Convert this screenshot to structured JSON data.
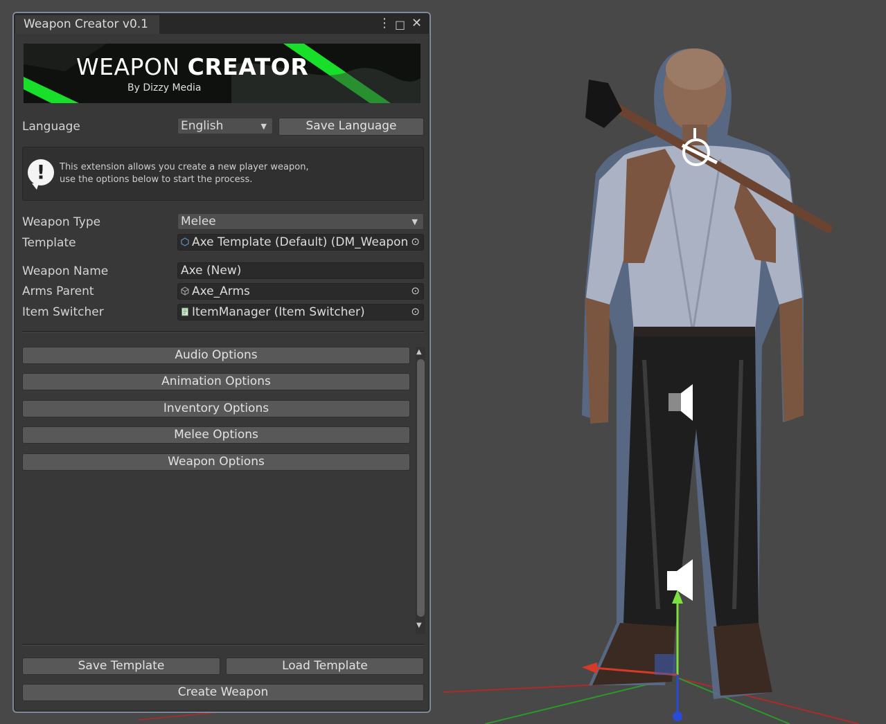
{
  "window": {
    "tab_title": "Weapon Creator v0.1",
    "controls": {
      "menu": "⋮",
      "maximize": "□",
      "close": "✕"
    }
  },
  "banner": {
    "title_light": "WEAPON",
    "title_bold": "CREATOR",
    "subtitle": "By Dizzy Media",
    "accent_color": "#18e02a"
  },
  "language": {
    "label": "Language",
    "selected": "English",
    "save_button": "Save Language"
  },
  "help": {
    "icon": "info-bubble-icon",
    "line1": "This extension allows you create a new player weapon,",
    "line2": "use the options below to start the process."
  },
  "fields": {
    "weapon_type": {
      "label": "Weapon Type",
      "value": "Melee"
    },
    "template": {
      "label": "Template",
      "value": "Axe Template (Default) (DM_Weapon"
    },
    "weapon_name": {
      "label": "Weapon Name",
      "value": "Axe (New)"
    },
    "arms_parent": {
      "label": "Arms Parent",
      "value": "Axe_Arms"
    },
    "item_switcher": {
      "label": "Item Switcher",
      "value": "ItemManager (Item Switcher)"
    }
  },
  "option_sections": [
    {
      "label": "Audio Options"
    },
    {
      "label": "Animation Options"
    },
    {
      "label": "Inventory Options"
    },
    {
      "label": "Melee Options"
    },
    {
      "label": "Weapon Options"
    }
  ],
  "footer": {
    "save_template": "Save Template",
    "load_template": "Load Template",
    "create_weapon": "Create Weapon"
  },
  "scene": {
    "background_color": "#484848",
    "icons": [
      "audio-source-icon",
      "move-gizmo-icon",
      "transform-gizmo-icon"
    ]
  }
}
